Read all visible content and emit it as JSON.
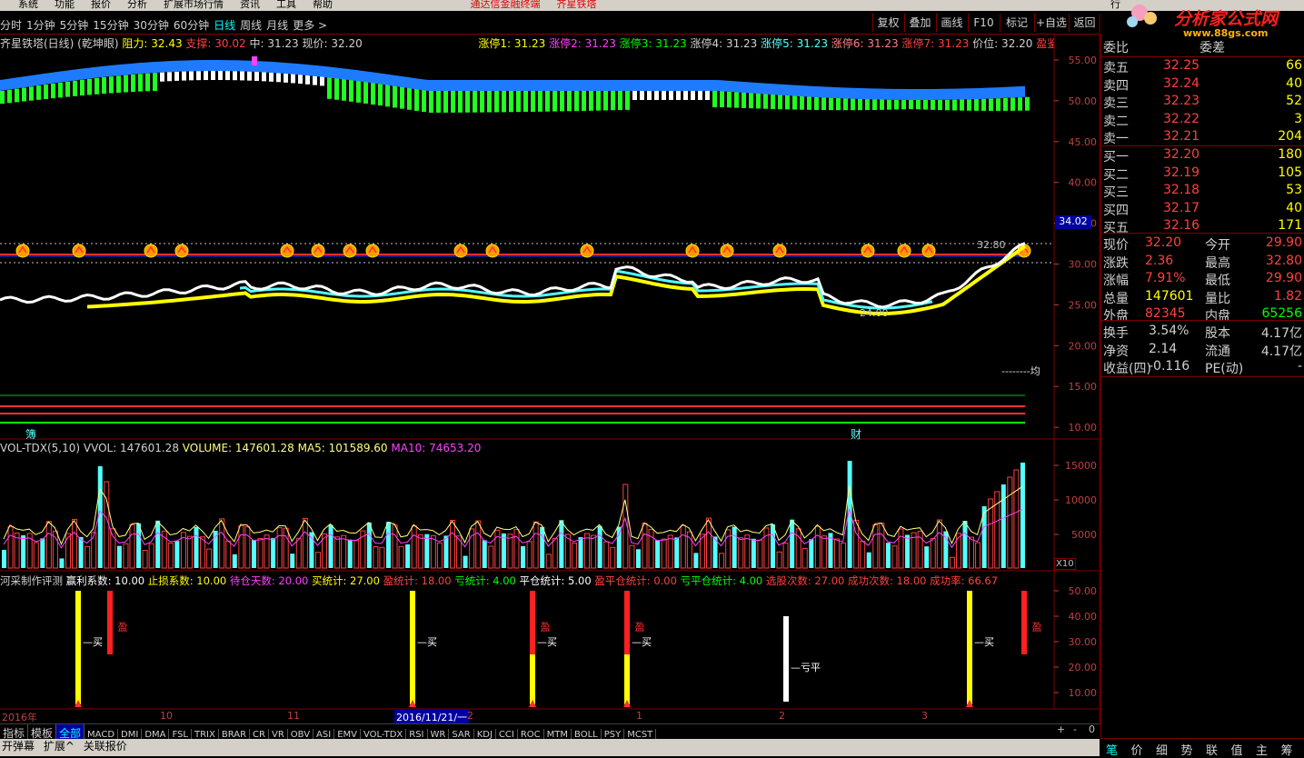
{
  "menubar": {
    "items": [
      "系统",
      "功能",
      "报价",
      "分析",
      "扩展市场行情",
      "资讯",
      "工具",
      "帮助"
    ],
    "center_title": "通达信金融终端",
    "stock_title": "齐星铁塔",
    "right_label": "行"
  },
  "periods": {
    "items": [
      "分时",
      "1分钟",
      "5分钟",
      "15分钟",
      "30分钟",
      "60分钟",
      "日线",
      "周线",
      "月线",
      "更多 >"
    ],
    "active": "日线"
  },
  "toolbar": {
    "buttons": [
      "复权",
      "叠加",
      "画线",
      "F10",
      "标记",
      "+自选",
      "返回"
    ]
  },
  "logo": {
    "text": "分析家公式网",
    "url": "www.88gs.com"
  },
  "main_chart": {
    "header": {
      "name": "齐星铁塔(日线) (乾坤眼)",
      "resist_label": "阻力: 32.43",
      "support_label": "支撑: 30.02",
      "mid_label": "中: 31.23",
      "price_label": "现价: 32.20"
    },
    "limits": [
      "涨停1: 31.23",
      "涨停2: 31.23",
      "涨停3: 31.23",
      "涨停4: 31.23",
      "涨停5: 31.23",
      "涨停6: 31.23",
      "涨停7: 31.23"
    ],
    "extra": [
      "价位: 32.20",
      "盈鉴",
      "◇",
      "□"
    ],
    "y_ticks": [
      "55.00",
      "50.00",
      "45.00",
      "40.00",
      "35.00",
      "30.00",
      "25.00",
      "20.00",
      "15.00",
      "10.00"
    ],
    "price_tag": "34.02",
    "high_label": "32.80",
    "low_label": "24.00",
    "avg_label": "--------均",
    "bottom_left_label": "簿",
    "bottom_mid_label": "财"
  },
  "vol_chart": {
    "header": {
      "name": "VOL-TDX(5,10)",
      "vvol": "VVOL: 147601.28",
      "volume": "VOLUME: 147601.28",
      "ma5": "MA5: 101589.60",
      "ma10": "MA10: 74653.20"
    },
    "y_ticks": [
      "15000",
      "10000",
      "5000"
    ],
    "unit": "X10"
  },
  "eval_chart": {
    "header": [
      "河采制作评测",
      "赢利系数: 10.00",
      "止损系数: 10.00",
      "待仓天数: 20.00",
      "买统计: 27.00",
      "盈统计: 18.00",
      "亏统计: 4.00",
      "平仓统计: 5.00",
      "盈平仓统计: 0.00",
      "亏平仓统计: 4.00",
      "选股次数: 27.00",
      "成功次数: 18.00",
      "成功率: 66.67"
    ],
    "y_ticks": [
      "50.00",
      "40.00",
      "30.00",
      "20.00",
      "10.00"
    ],
    "labels": {
      "buy": "买",
      "win": "盈",
      "lose_flat": "亏平"
    }
  },
  "time_axis": {
    "labels": [
      "2016年",
      "10",
      "11",
      "2016/11/21/一",
      "2",
      "1",
      "2",
      "3"
    ]
  },
  "indicator_tabs": {
    "items": [
      "指标",
      "模板",
      "全部",
      "MACD",
      "DMI",
      "DMA",
      "FSL",
      "TRIX",
      "BRAR",
      "CR",
      "VR",
      "OBV",
      "ASI",
      "EMV",
      "VOL-TDX",
      "RSI",
      "WR",
      "SAR",
      "KDJ",
      "CCI",
      "ROC",
      "MTM",
      "BOLL",
      "PSY",
      "MCST"
    ],
    "active": "全部",
    "right": [
      "+",
      "-",
      "0"
    ]
  },
  "footer_tabs": {
    "items": [
      "开弹幕",
      "扩展^",
      "关联报价"
    ]
  },
  "right_panel": {
    "weibi": {
      "label": "委比",
      "value": "",
      "label2": "委差"
    },
    "sells": [
      {
        "label": "卖五",
        "price": "32.25",
        "vol": "66"
      },
      {
        "label": "卖四",
        "price": "32.24",
        "vol": "40"
      },
      {
        "label": "卖三",
        "price": "32.23",
        "vol": "52"
      },
      {
        "label": "卖二",
        "price": "32.22",
        "vol": "3"
      },
      {
        "label": "卖一",
        "price": "32.21",
        "vol": "204"
      }
    ],
    "buys": [
      {
        "label": "买一",
        "price": "32.20",
        "vol": "180"
      },
      {
        "label": "买二",
        "price": "32.19",
        "vol": "105"
      },
      {
        "label": "买三",
        "price": "32.18",
        "vol": "53"
      },
      {
        "label": "买四",
        "price": "32.17",
        "vol": "40"
      },
      {
        "label": "买五",
        "price": "32.16",
        "vol": "171"
      }
    ],
    "stats": [
      {
        "l1": "现价",
        "v1": "32.20",
        "l2": "今开",
        "v2": "29.90",
        "c1": "#ff4040",
        "c2": "#ff4040"
      },
      {
        "l1": "涨跌",
        "v1": "2.36",
        "l2": "最高",
        "v2": "32.80",
        "c1": "#ff4040",
        "c2": "#ff4040"
      },
      {
        "l1": "涨幅",
        "v1": "7.91%",
        "l2": "最低",
        "v2": "29.90",
        "c1": "#ff4040",
        "c2": "#ff4040"
      },
      {
        "l1": "总量",
        "v1": "147601",
        "l2": "量比",
        "v2": "1.82",
        "c1": "#ffff00",
        "c2": "#ff4040"
      },
      {
        "l1": "外盘",
        "v1": "82345",
        "l2": "内盘",
        "v2": "65256",
        "c1": "#ff4040",
        "c2": "#00ff00"
      }
    ],
    "stats2": [
      {
        "l1": "换手",
        "v1": "3.54%",
        "l2": "股本",
        "v2": "4.17亿"
      },
      {
        "l1": "净资",
        "v1": "2.14",
        "l2": "流通",
        "v2": "4.17亿"
      },
      {
        "l1": "收益(四)",
        "v1": "-0.116",
        "l2": "PE(动)",
        "v2": "-"
      }
    ],
    "bottom_tabs": [
      "笔",
      "价",
      "细",
      "势",
      "联",
      "值",
      "主",
      "筹"
    ]
  },
  "colors": {
    "up": "#ff4040",
    "down": "#54ffff",
    "grid": "#800000",
    "yellow": "#ffff00",
    "green": "#00ff00"
  }
}
